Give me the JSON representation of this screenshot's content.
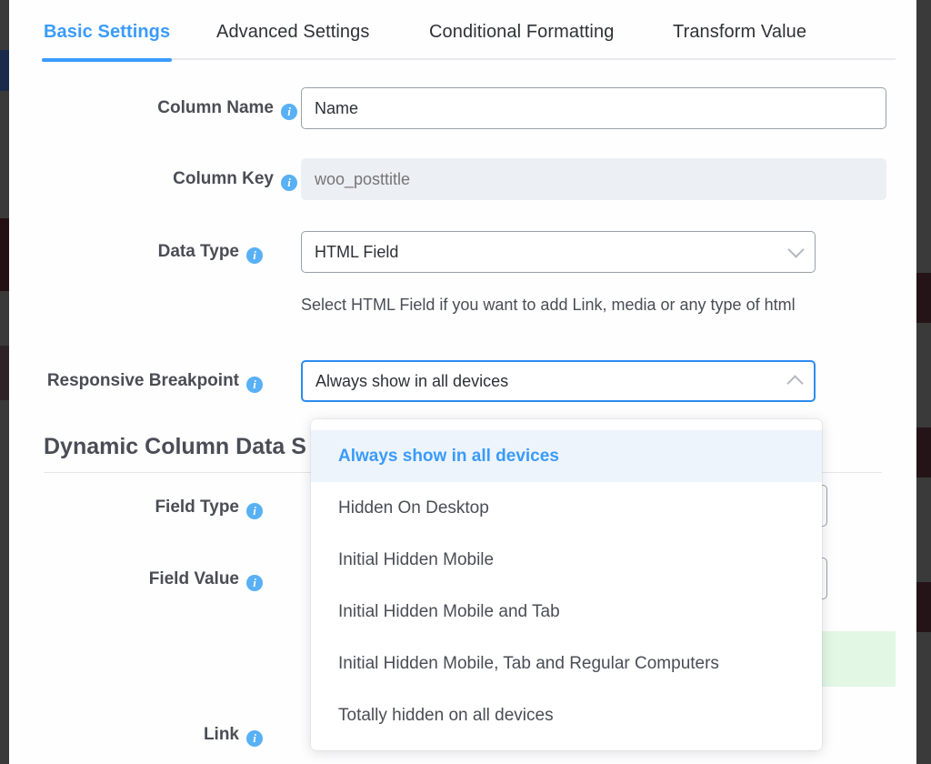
{
  "window": {
    "backdrop_color": "#3a3a3a",
    "panel_background": "#fefefe"
  },
  "tabs": [
    {
      "label": "Basic Settings",
      "active": true
    },
    {
      "label": "Advanced Settings",
      "active": false
    },
    {
      "label": "Conditional Formatting",
      "active": false
    },
    {
      "label": "Transform Value",
      "active": false
    }
  ],
  "basic_settings": {
    "column_name": {
      "label": "Column Name",
      "value": "Name",
      "placeholder": "Column Name"
    },
    "column_key": {
      "label": "Column Key",
      "value": "",
      "placeholder": "woo_posttitle",
      "disabled": true
    },
    "data_type": {
      "label": "Data Type",
      "value": "HTML Field",
      "helper": "Select HTML Field if you want to add Link, media or any type of html"
    },
    "responsive_breakpoint": {
      "label": "Responsive Breakpoint",
      "value": "Always show in all devices",
      "expanded": true,
      "options": [
        "Always show in all devices",
        "Hidden On Desktop",
        "Initial Hidden Mobile",
        "Initial Hidden Mobile and Tab",
        "Initial Hidden Mobile, Tab and Regular Computers",
        "Totally hidden on all devices"
      ],
      "selected_index": 0
    }
  },
  "dynamic_section": {
    "heading": "Dynamic Column Data S",
    "fields": [
      {
        "label": "Field Type"
      },
      {
        "label": "Field Value"
      },
      {
        "label": "Link"
      }
    ]
  },
  "icons": {
    "info": "i",
    "chevron_down": "chevron-down-icon",
    "chevron_up": "chevron-up-icon"
  },
  "colors": {
    "accent": "#3a9bfc",
    "focus_border": "#2b8cf0",
    "info_badge": "#58b0f5",
    "label_text": "#4a4d55",
    "disabled_field": "#eceff3",
    "highlight_row": "#eef4fb",
    "green_block": "#e2f7e4"
  }
}
